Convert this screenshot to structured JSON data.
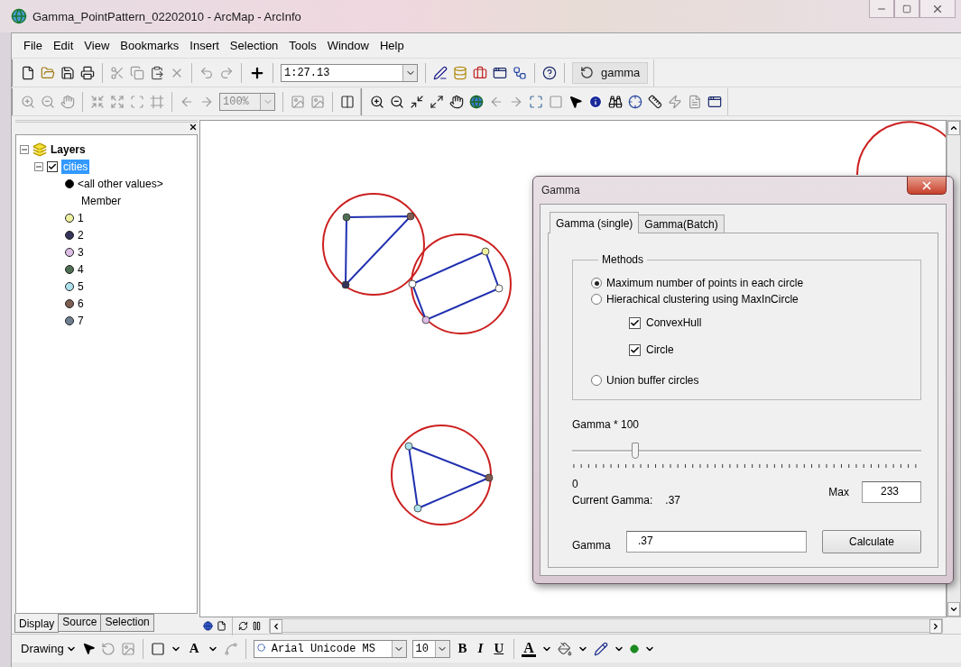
{
  "window": {
    "title": "Gamma_PointPattern_02202010 - ArcMap - ArcInfo"
  },
  "menu": [
    {
      "label": "File"
    },
    {
      "label": "Edit"
    },
    {
      "label": "View"
    },
    {
      "label": "Bookmarks"
    },
    {
      "label": "Insert"
    },
    {
      "label": "Selection"
    },
    {
      "label": "Tools"
    },
    {
      "label": "Window"
    },
    {
      "label": "Help"
    }
  ],
  "standard_toolbar": {
    "scale": "1:27.13",
    "gamma_button": "gamma"
  },
  "tools_toolbar": {
    "zoom": "100%"
  },
  "toc": {
    "tree": [
      {
        "label": "Layers",
        "expanded": true,
        "children": [
          {
            "label": "cities",
            "checked": true,
            "selected": true,
            "expanded": true,
            "legend": {
              "default": {
                "label": "<all other values>",
                "color": "#000000"
              },
              "field": "Member",
              "classes": [
                {
                  "label": "1",
                  "color": "#eef2a0"
                },
                {
                  "label": "2",
                  "color": "#34345a"
                },
                {
                  "label": "3",
                  "color": "#dcbde6"
                },
                {
                  "label": "4",
                  "color": "#4e6e52"
                },
                {
                  "label": "5",
                  "color": "#ade2ec"
                },
                {
                  "label": "6",
                  "color": "#7d5e52"
                },
                {
                  "label": "7",
                  "color": "#6e8090"
                }
              ]
            }
          }
        ]
      }
    ],
    "tabs": [
      {
        "label": "Display",
        "selected": true
      },
      {
        "label": "Source",
        "selected": false
      },
      {
        "label": "Selection",
        "selected": false
      }
    ]
  },
  "dialog": {
    "title": "Gamma",
    "tabs": [
      {
        "label": "Gamma (single)",
        "selected": true
      },
      {
        "label": "Gamma(Batch)",
        "selected": false
      }
    ],
    "methods": {
      "title": "Methods",
      "options": [
        {
          "label": "Maximum number of points in each circle",
          "selected": true
        },
        {
          "label": "Hierachical clustering using MaxInCircle",
          "selected": false,
          "children": [
            {
              "label": "ConvexHull",
              "checked": true
            },
            {
              "label": "Circle",
              "checked": true
            }
          ]
        },
        {
          "label": "Union buffer circles",
          "selected": false
        }
      ]
    },
    "slider": {
      "label": "Gamma * 100",
      "level": 0.18,
      "min_label": "0"
    },
    "current_gamma": {
      "label": "Current Gamma:",
      "value": ".37"
    },
    "max": {
      "label": "Max",
      "value": "233"
    },
    "gamma": {
      "label": "Gamma",
      "value": ".37"
    },
    "calculate_button": "Calculate"
  },
  "drawing_toolbar": {
    "menu": "Drawing",
    "text_tool": "A",
    "font": "Arial Unicode MS",
    "size": "10",
    "bold": "B",
    "italic": "I",
    "underline": "U",
    "font_color": "A"
  }
}
